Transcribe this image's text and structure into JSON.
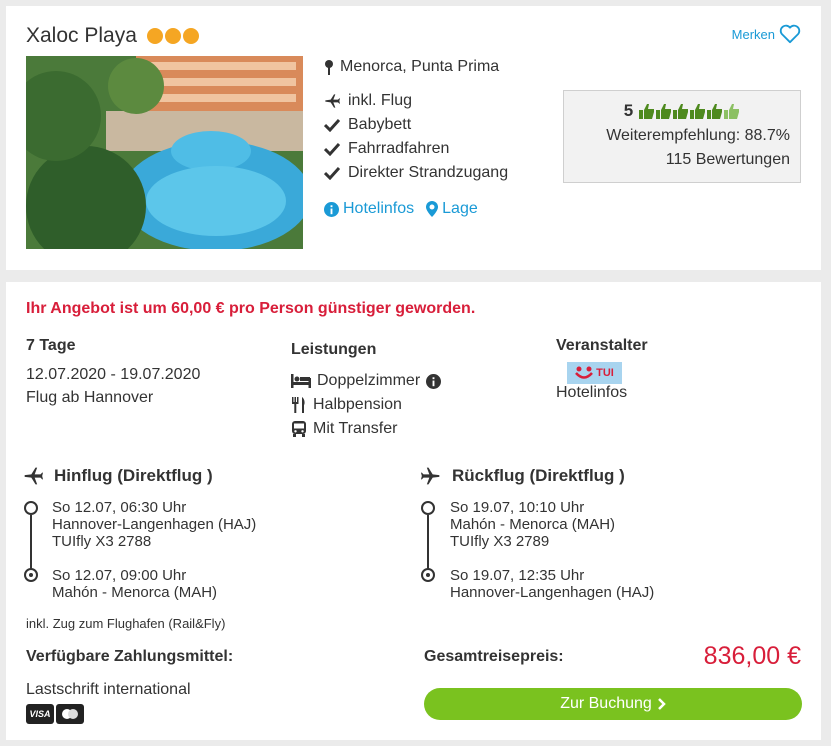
{
  "hotel": {
    "name": "Xaloc Playa",
    "stars": 3,
    "star_color": "#f5a623",
    "merken_label": "Merken",
    "location": "Menorca, Punta Prima",
    "features": [
      "inkl. Flug",
      "Babybett",
      "Fahrradfahren",
      "Direkter Strandzugang"
    ],
    "links": {
      "hotelinfos": "Hotelinfos",
      "lage": "Lage"
    },
    "rating": {
      "score": "5",
      "thumbs": 6,
      "recommendation": "Weiterempfehlung: 88.7%",
      "reviews": "115 Bewertungen"
    }
  },
  "offer": {
    "promo": "Ihr Angebot ist um 60,00 € pro Person günstiger geworden.",
    "duration": "7 Tage",
    "dates": "12.07.2020 - 19.07.2020",
    "departure": "Flug ab Hannover",
    "services_title": "Leistungen",
    "services": [
      "Doppelzimmer",
      "Halbpension",
      "Mit Transfer"
    ],
    "operator_title": "Veranstalter",
    "operator_logo": "TUI",
    "operator_link": "Hotelinfos"
  },
  "outbound": {
    "title": "Hinflug (Direktflug )",
    "dep_time": "So 12.07, 06:30 Uhr",
    "dep_airport": "Hannover-Langenhagen (HAJ)",
    "flight": "TUIfly X3 2788",
    "arr_time": "So 12.07, 09:00 Uhr",
    "arr_airport": "Mahón - Menorca (MAH)"
  },
  "return": {
    "title": "Rückflug (Direktflug )",
    "dep_time": "So 19.07, 10:10 Uhr",
    "dep_airport": "Mahón - Menorca (MAH)",
    "flight": "TUIfly X3 2789",
    "arr_time": "So 19.07, 12:35 Uhr",
    "arr_airport": "Hannover-Langenhagen (HAJ)"
  },
  "rail_note": "inkl. Zug zum Flughafen (Rail&Fly)",
  "payment": {
    "title": "Verfügbare Zahlungsmittel:",
    "method": "Lastschrift international",
    "cards": [
      "VISA",
      "Mastercard"
    ]
  },
  "total": {
    "label": "Gesamtreisepreis:",
    "price": "836,00 €"
  },
  "booking_button": "Zur Buchung",
  "colors": {
    "accent": "#1a9ad6",
    "price": "#d81e3a",
    "button": "#7ac21f",
    "thumbs": "#6aaa2a"
  }
}
